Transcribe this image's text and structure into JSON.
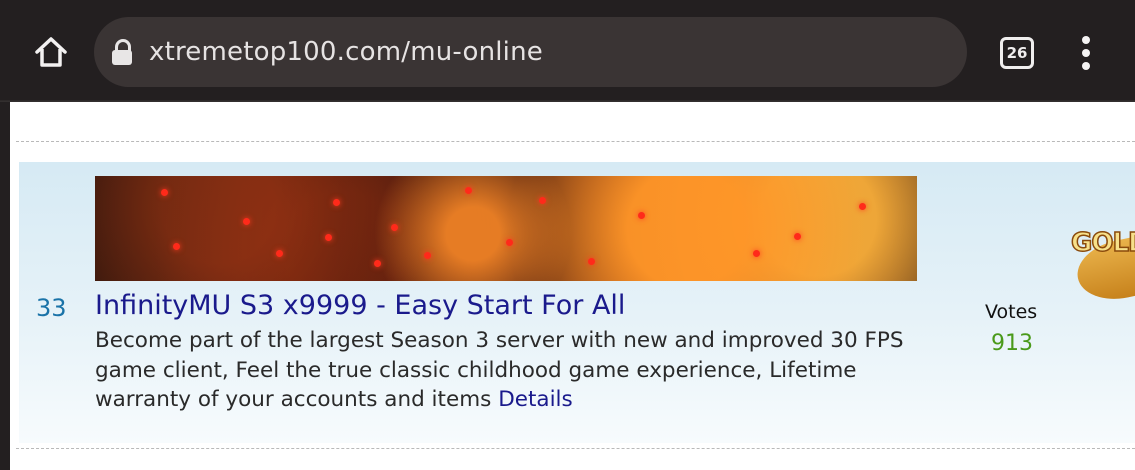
{
  "browser": {
    "url": "xtremetop100.com/mu-online",
    "tab_count": "26"
  },
  "listing": {
    "rank": "33",
    "title": "InfinityMU S3 x9999 - Easy Start For All",
    "description": "Become part of the largest Season 3 server with new and improved 30 FPS game client, Feel the true classic childhood game experience, Lifetime warranty of your accounts and items",
    "details_label": "Details",
    "votes_label": "Votes",
    "votes_count": "913",
    "badge_text": "GOLD"
  },
  "colors": {
    "chrome_bg": "#231f20",
    "urlbar_bg": "#3a3434",
    "rank": "#1a73a8",
    "title_link": "#1a1a8c",
    "votes_count": "#4a9a1a"
  }
}
